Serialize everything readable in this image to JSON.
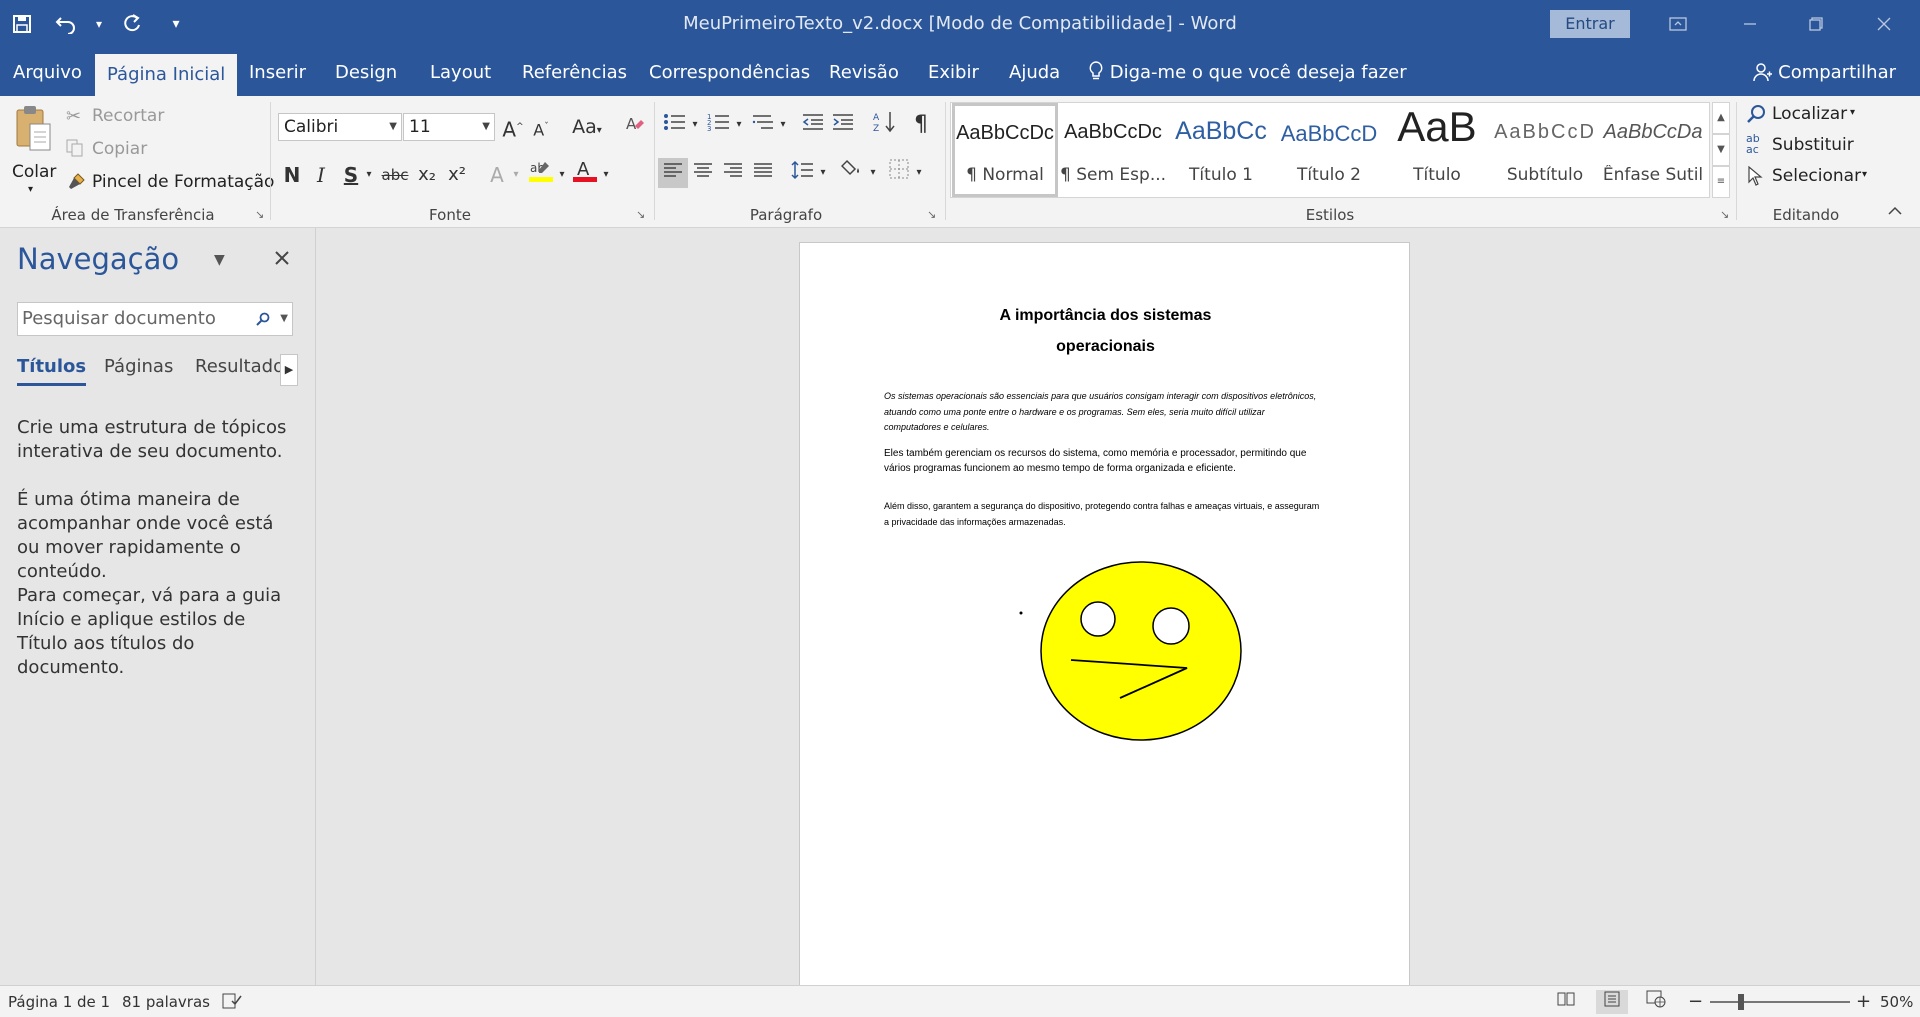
{
  "window": {
    "title": "MeuPrimeiroTexto_v2.docx [Modo de Compatibilidade]  -  Word",
    "signin_label": "Entrar"
  },
  "qat": {
    "icons": [
      "save-icon",
      "undo-icon",
      "redo-icon",
      "customize-qat-icon"
    ]
  },
  "tabs": {
    "arquivo": "Arquivo",
    "pagina_inicial": "Página Inicial",
    "inserir": "Inserir",
    "design": "Design",
    "layout": "Layout",
    "referencias": "Referências",
    "correspondencias": "Correspondências",
    "revisao": "Revisão",
    "exibir": "Exibir",
    "ajuda": "Ajuda",
    "active": "Página Inicial"
  },
  "tell_me": "Diga-me o que você deseja fazer",
  "share_label": "Compartilhar",
  "clipboard": {
    "paste": "Colar",
    "cut": "Recortar",
    "copy": "Copiar",
    "format_painter": "Pincel de Formatação",
    "group_label": "Área de Transferência"
  },
  "font": {
    "font_name": "Calibri",
    "font_size": "11",
    "change_case": "Aa",
    "bold": "N",
    "italic": "I",
    "underline": "S",
    "strikethrough": "abc",
    "subscript": "x₂",
    "superscript": "x²",
    "highlight_color": "#ffff00",
    "font_color": "#e81123",
    "group_label": "Fonte"
  },
  "paragraph": {
    "group_label": "Parágrafo"
  },
  "styles": {
    "items": [
      {
        "preview": "AaBbCcDc",
        "name": "¶ Normal"
      },
      {
        "preview": "AaBbCcDc",
        "name": "¶ Sem Esp..."
      },
      {
        "preview": "AaBbCc",
        "name": "Título 1"
      },
      {
        "preview": "AaBbCcD",
        "name": "Título 2"
      },
      {
        "preview": "AaB",
        "name": "Título"
      },
      {
        "preview": "AaBbCcD",
        "name": "Subtítulo"
      },
      {
        "preview": "AaBbCcDa",
        "name": "Ênfase Sutil"
      }
    ],
    "selected": "¶ Normal",
    "group_label": "Estilos"
  },
  "editing": {
    "find": "Localizar",
    "replace": "Substituir",
    "select": "Selecionar",
    "group_label": "Editando"
  },
  "nav_pane": {
    "title": "Navegação",
    "search_placeholder": "Pesquisar documento",
    "tabs": [
      "Títulos",
      "Páginas",
      "Resultados"
    ],
    "active_tab": "Títulos",
    "paragraphs": [
      "Crie uma estrutura de tópicos interativa de seu documento.",
      "É uma ótima maneira de acompanhar onde você está ou mover rapidamente o conteúdo.",
      "Para começar, vá para a guia Início e aplique estilos de Título aos títulos do documento."
    ]
  },
  "document": {
    "title_line1": "A importância dos sistemas",
    "title_line2": "operacionais",
    "paragraphs": [
      "Os sistemas operacionais são essenciais para que usuários consigam interagir com dispositivos eletrônicos, atuando como uma ponte entre o hardware e os programas. Sem eles, seria muito difícil utilizar computadores e celulares.",
      "Eles também gerenciam os recursos do sistema, como memória e processador, permitindo que vários programas funcionem ao mesmo tempo de forma organizada e eficiente.",
      "Além disso, garantem a segurança do dispositivo, protegendo contra falhas e ameaças virtuais, e asseguram a privacidade das informações armazenadas."
    ],
    "drawing": {
      "face_color": "#ffff00",
      "outline_color": "#000000"
    }
  },
  "status_bar": {
    "page": "Página 1 de 1",
    "words": "81 palavras",
    "zoom_level": "50%",
    "zoom_minus": "−",
    "zoom_plus": "+"
  }
}
